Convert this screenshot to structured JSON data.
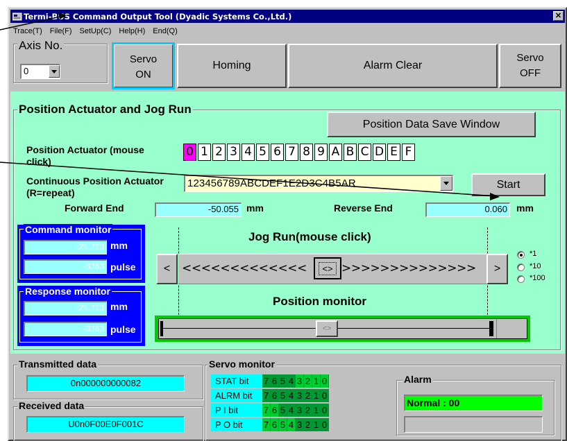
{
  "window": {
    "title": "Termi-BUS Command Output Tool (Dyadic Systems Co.,Ltd.)",
    "close_glyph": "✕"
  },
  "menu": [
    {
      "label": "Trace(T)"
    },
    {
      "label": "File(F)"
    },
    {
      "label": "SetUp(C)"
    },
    {
      "label": "Help(H)"
    },
    {
      "label": "End(Q)"
    }
  ],
  "axis": {
    "label": "Axis No.",
    "value": "0"
  },
  "top_buttons": {
    "servo_on": "Servo ON",
    "homing": "Homing",
    "alarm_clear": "Alarm Clear",
    "servo_off": "Servo OFF"
  },
  "position": {
    "group_label": "Position Actuator and Jog Run",
    "save_window_button": "Position Data Save Window",
    "actuator_label": "Position Actuator (mouse click)",
    "hex_cells": [
      "0",
      "1",
      "2",
      "3",
      "4",
      "5",
      "6",
      "7",
      "8",
      "9",
      "A",
      "B",
      "C",
      "D",
      "E",
      "F"
    ],
    "selected_cell": "0",
    "continuous_label": "Continuous Position Actuator  (R=repeat)",
    "continuous_value": "123456789ABCDEF1E2D3C4B5AR",
    "start_button": "Start",
    "forward_end_label": "Forward End",
    "forward_end_value": "-50.055",
    "reverse_end_label": "Reverse End",
    "reverse_end_value": "0.060",
    "unit_mm": "mm"
  },
  "command_monitor": {
    "label": "Command monitor",
    "mm_value": "-25.223",
    "mm_unit": "mm",
    "pulse_value": "-3363",
    "pulse_unit": "pulse"
  },
  "response_monitor": {
    "label": "Response monitor",
    "mm_value": "-25.223",
    "mm_unit": "mm",
    "pulse_value": "-3363",
    "pulse_unit": "pulse"
  },
  "jog": {
    "label": "Jog Run(mouse click)",
    "left_button": "<",
    "right_button": ">",
    "left_arrows": "<<<<<<<<<<<<<",
    "right_arrows": ">>>>>>>>>>>>>>",
    "thumb": "<>",
    "rates": [
      "*1",
      "*10",
      "*100"
    ],
    "selected_rate": "*1"
  },
  "position_monitor": {
    "label": "Position monitor",
    "thumb": "<>"
  },
  "transmitted": {
    "label": "Transmitted data",
    "value": "0n000000000082"
  },
  "received": {
    "label": "Received data",
    "value": "U0n0F00E0F001C"
  },
  "servo_monitor": {
    "label": "Servo monitor",
    "rows": [
      {
        "name": "STAT  bit",
        "bits": [
          "7",
          "6",
          "5",
          "4",
          "3",
          "2",
          "1",
          "0"
        ]
      },
      {
        "name": "ALRM  bit",
        "bits": [
          "7",
          "6",
          "5",
          "4",
          "3",
          "2",
          "1",
          "0"
        ]
      },
      {
        "name": "P I    bit",
        "bits": [
          "7",
          "6",
          "5",
          "4",
          "3",
          "2",
          "1",
          "0"
        ]
      },
      {
        "name": "P O   bit",
        "bits": [
          "7",
          "6",
          "5",
          "4",
          "3",
          "2",
          "1",
          "0"
        ]
      }
    ]
  },
  "alarm": {
    "label": "Alarm",
    "status": "Normal : 00",
    "detail": ""
  },
  "colors": {
    "title_bar": "#000080",
    "panel_green": "#99ffcc",
    "monitor_blue": "#0000ff",
    "cyan": "#99ffff",
    "selected_magenta": "#ff00ff",
    "alarm_green": "#00ff00"
  }
}
